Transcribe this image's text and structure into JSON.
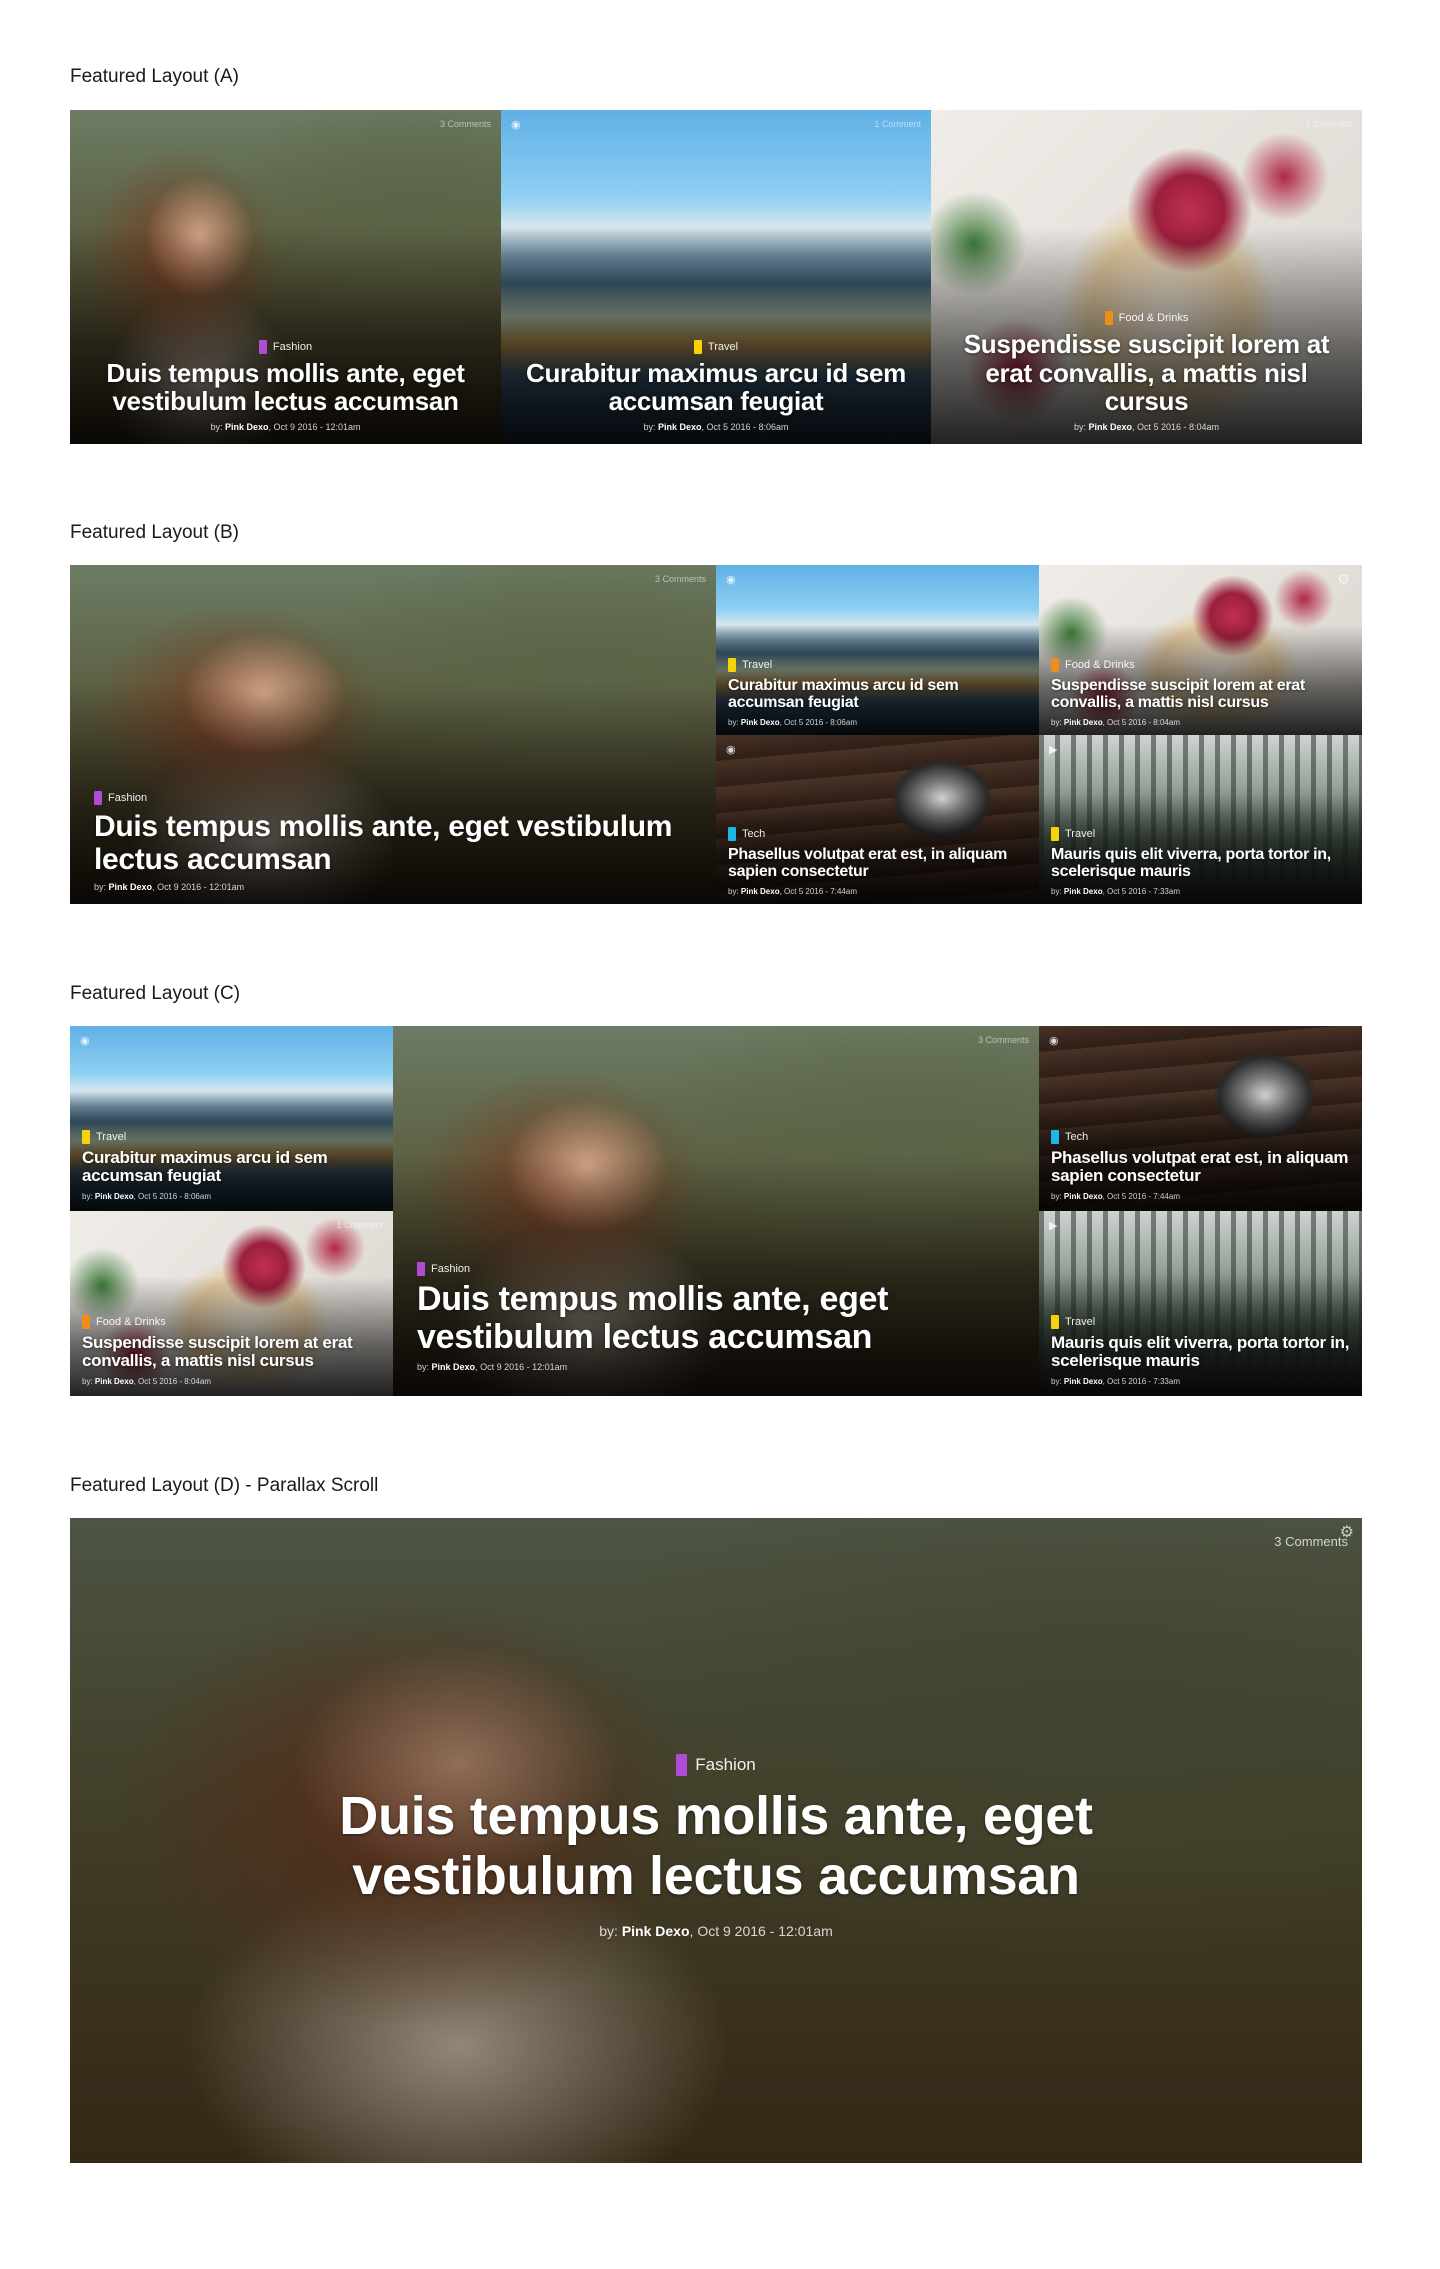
{
  "sections": {
    "a": {
      "label": "Featured Layout (A)"
    },
    "b": {
      "label": "Featured Layout (B)"
    },
    "c": {
      "label": "Featured Layout (C)"
    },
    "d": {
      "label": "Featured Layout (D) - Parallax Scroll"
    }
  },
  "colors": {
    "fashion": "#b14ad6",
    "travel": "#f5d20a",
    "food": "#f08c1a",
    "tech": "#1fb6e6"
  },
  "posts": {
    "fashion": {
      "category": "Fashion",
      "title": "Duis tempus mollis ante, eget vestibulum lectus accumsan",
      "by": "by:",
      "author": "Pink Dexo",
      "date": "Oct 9 2016 - 12:01am",
      "comments": "3 Comments"
    },
    "travel_lake": {
      "category": "Travel",
      "title": "Curabitur maximus arcu id sem accumsan feugiat",
      "by": "by:",
      "author": "Pink Dexo",
      "date": "Oct 5 2016 - 8:06am",
      "comments": "1 Comment"
    },
    "food": {
      "category": "Food & Drinks",
      "title": "Suspendisse suscipit lorem at erat convallis, a mattis nisl cursus",
      "by": "by:",
      "author": "Pink Dexo",
      "date": "Oct 5 2016 - 8:04am",
      "comments": "1 Comment"
    },
    "tech": {
      "category": "Tech",
      "title": "Phasellus volutpat erat est, in aliquam sapien consectetur",
      "by": "by:",
      "author": "Pink Dexo",
      "date": "Oct 5 2016 - 7:44am"
    },
    "travel_forest": {
      "category": "Travel",
      "title": "Mauris quis elit viverra, porta tortor in, scelerisque mauris",
      "by": "by:",
      "author": "Pink Dexo",
      "date": "Oct 5 2016 - 7:33am"
    }
  },
  "icons": {
    "camera": "camera-icon",
    "video": "video-icon",
    "gear": "gear-icon"
  }
}
